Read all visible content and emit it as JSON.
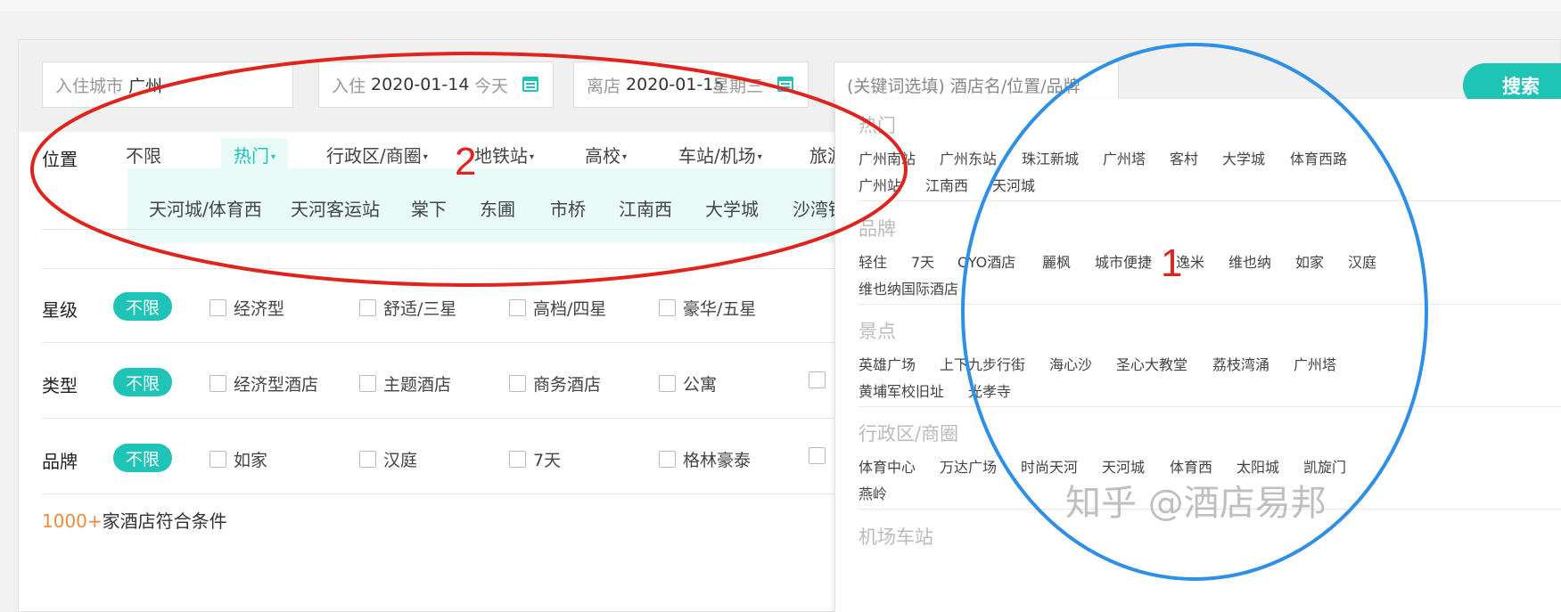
{
  "search": {
    "city_label": "入住城市",
    "city_value": "广州",
    "checkin_label": "入住",
    "checkin_date": "2020-01-14",
    "checkin_day": "今天",
    "separator": "-",
    "checkout_label": "离店",
    "checkout_date": "2020-01-15",
    "checkout_day": "星期三",
    "keyword_placeholder": "(关键词选填) 酒店名/位置/品牌",
    "search_button": "搜索"
  },
  "location": {
    "label": "位置",
    "tabs": [
      "不限",
      "热门",
      "行政区/商圈",
      "地铁站",
      "高校",
      "车站/机场",
      "旅游"
    ],
    "hot_items": [
      "天河城/体育西",
      "天河客运站",
      "棠下",
      "东圃",
      "市桥",
      "江南西",
      "大学城",
      "沙湾镇"
    ]
  },
  "filters": [
    {
      "label": "星级",
      "all": "不限",
      "options": [
        "经济型",
        "舒适/三星",
        "高档/四星",
        "豪华/五星"
      ]
    },
    {
      "label": "类型",
      "all": "不限",
      "options": [
        "经济型酒店",
        "主题酒店",
        "商务酒店",
        "公寓"
      ]
    },
    {
      "label": "品牌",
      "all": "不限",
      "options": [
        "如家",
        "汉庭",
        "7天",
        "格林豪泰"
      ]
    }
  ],
  "result": {
    "count": "1000+",
    "text": "家酒店符合条件"
  },
  "dropdown": {
    "sections": [
      {
        "title": "热门",
        "rows": [
          [
            "广州南站",
            "广州东站",
            "珠江新城",
            "广州塔",
            "客村",
            "大学城",
            "体育西路"
          ],
          [
            "广州站",
            "江南西",
            "天河城"
          ]
        ]
      },
      {
        "title": "品牌",
        "rows": [
          [
            "轻住",
            "7天",
            "OYO酒店",
            "麗枫",
            "城市便捷",
            "逸米",
            "维也纳",
            "如家",
            "汉庭"
          ],
          [
            "维也纳国际酒店"
          ]
        ]
      },
      {
        "title": "景点",
        "rows": [
          [
            "英雄广场",
            "上下九步行街",
            "海心沙",
            "圣心大教堂",
            "荔枝湾涌",
            "广州塔"
          ],
          [
            "黄埔军校旧址",
            "光孝寺"
          ]
        ]
      },
      {
        "title": "行政区/商圈",
        "rows": [
          [
            "体育中心",
            "万达广场",
            "时尚天河",
            "天河城",
            "体育西",
            "太阳城",
            "凯旋门"
          ],
          [
            "燕岭"
          ]
        ]
      },
      {
        "title": "机场车站",
        "rows": []
      }
    ]
  },
  "annotations": {
    "label_1": "1",
    "label_2": "2",
    "blue_color": "#2e8fe6",
    "red_color": "#e0231d"
  },
  "watermark": "知乎 @酒店易邦",
  "colors": {
    "accent": "#1ec4b6",
    "result_count": "#f08a3c"
  }
}
